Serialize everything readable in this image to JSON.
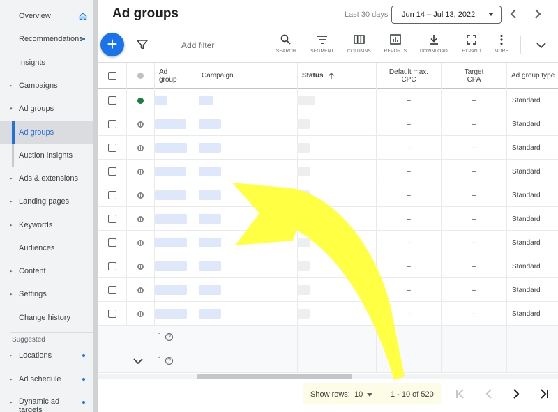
{
  "sidebar": {
    "items": [
      {
        "label": "Overview",
        "arrow": "",
        "dot": false,
        "home": true
      },
      {
        "label": "Recommendations",
        "arrow": "",
        "dot": true
      },
      {
        "label": "Insights",
        "arrow": "",
        "dot": false
      },
      {
        "label": "Campaigns",
        "arrow": "▸",
        "dot": false
      },
      {
        "label": "Ad groups",
        "arrow": "▾",
        "dot": false
      },
      {
        "label": "Ad groups",
        "arrow": "",
        "dot": false,
        "selected": true
      },
      {
        "label": "Auction insights",
        "arrow": "",
        "dot": false,
        "child": true
      },
      {
        "label": "Ads & extensions",
        "arrow": "▸",
        "dot": false
      },
      {
        "label": "Landing pages",
        "arrow": "▸",
        "dot": false
      },
      {
        "label": "Keywords",
        "arrow": "▸",
        "dot": false
      },
      {
        "label": "Audiences",
        "arrow": "",
        "dot": false
      },
      {
        "label": "Content",
        "arrow": "▸",
        "dot": false
      },
      {
        "label": "Settings",
        "arrow": "▸",
        "dot": false
      },
      {
        "label": "Change history",
        "arrow": "",
        "dot": false
      }
    ],
    "section_label": "Suggested",
    "suggested": [
      {
        "label": "Locations",
        "arrow": "▸",
        "dot": true
      },
      {
        "label": "Ad schedule",
        "arrow": "▸",
        "dot": true
      },
      {
        "label": "Dynamic ad targets",
        "arrow": "▸",
        "dot": true
      }
    ]
  },
  "header": {
    "title": "Ad groups",
    "date_label": "Last 30 days",
    "date_range": "Jun 14 – Jul 13, 2022"
  },
  "toolbar": {
    "add_filter": "Add filter",
    "tools": [
      {
        "label": "SEARCH",
        "icon": "search-icon"
      },
      {
        "label": "SEGMENT",
        "icon": "segment-icon"
      },
      {
        "label": "COLUMNS",
        "icon": "columns-icon"
      },
      {
        "label": "REPORTS",
        "icon": "reports-icon"
      },
      {
        "label": "DOWNLOAD",
        "icon": "download-icon"
      },
      {
        "label": "EXPAND",
        "icon": "expand-icon"
      },
      {
        "label": "MORE",
        "icon": "more-icon"
      }
    ]
  },
  "table": {
    "headers": {
      "ad_group": "Ad group",
      "campaign": "Campaign",
      "status": "Status",
      "default_cpc": "Default max. CPC",
      "target_cpa": "Target CPA",
      "ad_group_type": "Ad group type"
    },
    "rows": [
      {
        "status": "enabled",
        "cpc": "–",
        "cpa": "–",
        "type": "Standard"
      },
      {
        "status": "paused",
        "cpc": "–",
        "cpa": "–",
        "type": "Standard"
      },
      {
        "status": "paused",
        "cpc": "–",
        "cpa": "–",
        "type": "Standard"
      },
      {
        "status": "paused",
        "cpc": "–",
        "cpa": "–",
        "type": "Standard"
      },
      {
        "status": "paused",
        "cpc": "–",
        "cpa": "–",
        "type": "Standard"
      },
      {
        "status": "paused",
        "cpc": "–",
        "cpa": "–",
        "type": "Standard"
      },
      {
        "status": "paused",
        "cpc": "–",
        "cpa": "–",
        "type": "Standard"
      },
      {
        "status": "paused",
        "cpc": "–",
        "cpa": "–",
        "type": "Standard"
      },
      {
        "status": "paused",
        "cpc": "–",
        "cpa": "–",
        "type": "Standard"
      },
      {
        "status": "paused",
        "cpc": "–",
        "cpa": "–",
        "type": "Standard"
      }
    ],
    "total_marker": "-"
  },
  "footer": {
    "show_rows_label": "Show rows:",
    "rows_value": "10",
    "range_text": "1 - 10 of 520"
  },
  "colors": {
    "accent": "#1a73e8",
    "enabled": "#188038",
    "paused": "#80868b",
    "highlight_arrow": "#ffff33"
  }
}
